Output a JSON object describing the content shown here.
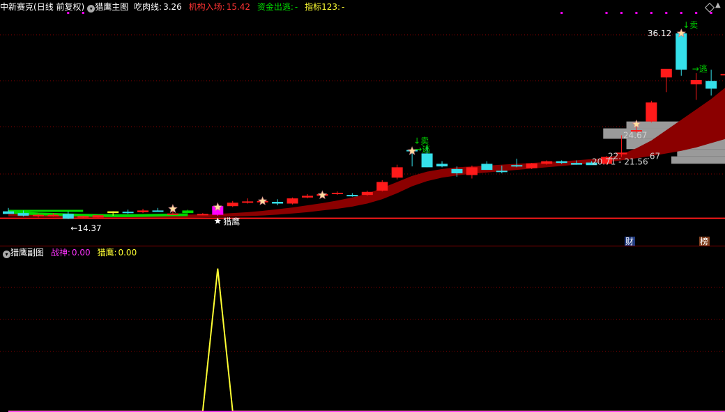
{
  "main_header": {
    "stock": "中新赛克",
    "period": "(日线 前复权)",
    "indicator_name": "猎鹰主图",
    "chi_rou_label": "吃肉线:",
    "chi_rou_value": "3.26",
    "ji_gou_label": "机构入场:",
    "ji_gou_value": "15.42",
    "zi_jin_label": "资金出逃:",
    "zi_jin_value": "-",
    "zhi_biao_label": "指标123:",
    "zhi_biao_value": "-"
  },
  "sub_header": {
    "indicator_name": "猎鹰副图",
    "zhan_shen_label": "战神:",
    "zhan_shen_value": "0.00",
    "lie_ying_label": "猎鹰:",
    "lie_ying_value": "0.00"
  },
  "annotations": {
    "low_price": "←14.37",
    "high_price": "36.12",
    "lie_ying_signal": "猎鹰",
    "escape_1": "→逃",
    "escape_2": "→逃",
    "sell_1": "↓卖",
    "sell_2": "↓卖",
    "zone_top": "24.67",
    "zone_mid": "22.",
    "zone_mid_right": ".67",
    "zone_low": "20.71 - 21.56",
    "badge_cai": "财",
    "badge_bang": "榜"
  },
  "colors": {
    "up": "#ff1a1a",
    "down": "#35e0ea",
    "band": "#8b0000",
    "green": "#00d800",
    "yellow": "#ffff33",
    "magenta": "#ff00ff",
    "grid": "#8b0000"
  },
  "chart_data": [
    {
      "type": "candlestick",
      "title": "中新赛克 (日线 前复权)",
      "ylim": [
        13.5,
        37.5
      ],
      "reference_line": 14.4,
      "candles": [
        {
          "o": 15.2,
          "h": 15.6,
          "l": 15.0,
          "c": 14.9,
          "col": "down"
        },
        {
          "o": 15.0,
          "h": 15.3,
          "l": 14.6,
          "c": 14.7,
          "col": "down"
        },
        {
          "o": 14.8,
          "h": 14.95,
          "l": 14.5,
          "c": 14.72,
          "col": "up"
        },
        {
          "o": 14.8,
          "h": 15.0,
          "l": 14.6,
          "c": 14.72,
          "col": "up"
        },
        {
          "o": 14.9,
          "h": 15.2,
          "l": 14.3,
          "c": 14.35,
          "col": "down"
        },
        {
          "o": 14.55,
          "h": 14.7,
          "l": 14.37,
          "c": 14.65,
          "col": "up"
        },
        {
          "o": 14.5,
          "h": 14.8,
          "l": 14.37,
          "c": 14.75,
          "col": "up"
        },
        {
          "o": 15.0,
          "h": 15.2,
          "l": 14.7,
          "c": 15.2,
          "col": "yellow"
        },
        {
          "o": 15.1,
          "h": 15.4,
          "l": 14.9,
          "c": 15.15,
          "col": "down"
        },
        {
          "o": 15.1,
          "h": 15.5,
          "l": 15.0,
          "c": 15.3,
          "col": "up"
        },
        {
          "o": 15.3,
          "h": 15.6,
          "l": 15.2,
          "c": 15.2,
          "col": "down"
        },
        {
          "o": 14.9,
          "h": 15.8,
          "l": 14.8,
          "c": 14.95,
          "col": "up"
        },
        {
          "o": 15.3,
          "h": 15.4,
          "l": 15.0,
          "c": 15.0,
          "col": "green"
        },
        {
          "o": 14.9,
          "h": 15.0,
          "l": 14.75,
          "c": 14.8,
          "col": "up"
        },
        {
          "o": 14.8,
          "h": 16.0,
          "l": 14.7,
          "c": 15.8,
          "col": "magenta"
        },
        {
          "o": 15.8,
          "h": 16.4,
          "l": 15.7,
          "c": 16.2,
          "col": "up"
        },
        {
          "o": 16.2,
          "h": 16.7,
          "l": 16.1,
          "c": 16.35,
          "col": "up"
        },
        {
          "o": 16.4,
          "h": 16.7,
          "l": 16.2,
          "c": 16.3,
          "col": "up"
        },
        {
          "o": 16.3,
          "h": 16.6,
          "l": 15.9,
          "c": 16.1,
          "col": "down"
        },
        {
          "o": 16.1,
          "h": 16.8,
          "l": 16.0,
          "c": 16.7,
          "col": "up"
        },
        {
          "o": 16.8,
          "h": 17.2,
          "l": 16.7,
          "c": 17.0,
          "col": "up"
        },
        {
          "o": 17.0,
          "h": 17.4,
          "l": 16.9,
          "c": 17.2,
          "col": "up"
        },
        {
          "o": 17.2,
          "h": 17.5,
          "l": 17.1,
          "c": 17.35,
          "col": "up"
        },
        {
          "o": 17.1,
          "h": 17.3,
          "l": 16.9,
          "c": 17.0,
          "col": "down"
        },
        {
          "o": 17.1,
          "h": 17.6,
          "l": 17.0,
          "c": 17.45,
          "col": "up"
        },
        {
          "o": 17.6,
          "h": 18.8,
          "l": 17.5,
          "c": 18.6,
          "col": "up"
        },
        {
          "o": 19.1,
          "h": 20.6,
          "l": 18.9,
          "c": 20.3,
          "col": "up"
        },
        {
          "o": 22.3,
          "h": 22.5,
          "l": 20.4,
          "c": 22.3,
          "col": "down"
        },
        {
          "o": 21.9,
          "h": 22.7,
          "l": 20.3,
          "c": 20.3,
          "col": "down"
        },
        {
          "o": 20.7,
          "h": 21.0,
          "l": 20.3,
          "c": 20.4,
          "col": "down"
        },
        {
          "o": 20.1,
          "h": 20.4,
          "l": 19.2,
          "c": 19.6,
          "col": "down"
        },
        {
          "o": 19.4,
          "h": 20.5,
          "l": 19.0,
          "c": 20.3,
          "col": "up"
        },
        {
          "o": 20.7,
          "h": 21.0,
          "l": 20.0,
          "c": 20.0,
          "col": "down"
        },
        {
          "o": 19.9,
          "h": 20.5,
          "l": 19.6,
          "c": 19.8,
          "col": "down"
        },
        {
          "o": 20.4,
          "h": 21.3,
          "l": 20.3,
          "c": 20.55,
          "col": "down"
        },
        {
          "o": 20.2,
          "h": 20.8,
          "l": 20.1,
          "c": 20.75,
          "col": "up"
        },
        {
          "o": 20.7,
          "h": 21.1,
          "l": 20.6,
          "c": 21.0,
          "col": "up"
        },
        {
          "o": 21.0,
          "h": 21.1,
          "l": 20.7,
          "c": 20.8,
          "col": "down"
        },
        {
          "o": 20.8,
          "h": 21.1,
          "l": 20.6,
          "c": 20.6,
          "col": "down"
        },
        {
          "o": 20.85,
          "h": 21.0,
          "l": 20.6,
          "c": 20.55,
          "col": "down"
        },
        {
          "o": 20.7,
          "h": 21.6,
          "l": 20.6,
          "c": 21.5,
          "col": "up"
        },
        {
          "o": 21.8,
          "h": 24.0,
          "l": 21.5,
          "c": 22.0,
          "col": "up"
        },
        {
          "o": 24.5,
          "h": 25.6,
          "l": 24.3,
          "c": 24.6,
          "col": "up"
        },
        {
          "o": 25.6,
          "h": 28.0,
          "l": 25.5,
          "c": 27.8,
          "col": "up"
        },
        {
          "o": 30.7,
          "h": 31.6,
          "l": 29.0,
          "c": 31.7,
          "col": "up"
        },
        {
          "o": 31.6,
          "h": 36.12,
          "l": 30.9,
          "c": 35.8,
          "col": "down"
        },
        {
          "o": 30.4,
          "h": 31.2,
          "l": 28.1,
          "c": 29.9,
          "col": "up"
        },
        {
          "o": 30.3,
          "h": 31.6,
          "l": 28.6,
          "c": 29.4,
          "col": "down"
        },
        {
          "o": 31.1,
          "h": 32.4,
          "l": 29.3,
          "c": 31.1,
          "col": "up"
        }
      ],
      "band": {
        "upper": [
          15.0,
          14.9,
          14.8,
          14.75,
          14.75,
          14.75,
          14.75,
          14.75,
          14.75,
          14.78,
          14.8,
          14.8,
          14.82,
          14.85,
          14.9,
          15.0,
          15.1,
          15.25,
          15.45,
          15.65,
          15.9,
          16.15,
          16.45,
          16.8,
          17.25,
          17.9,
          18.6,
          19.3,
          19.8,
          20.1,
          20.3,
          20.4,
          20.5,
          20.6,
          20.7,
          20.8,
          20.9,
          21.0,
          21.1,
          21.25,
          21.4,
          21.8,
          22.5,
          23.4,
          24.6,
          25.8,
          27.0,
          28.2,
          29.6
        ],
        "lower": [
          14.6,
          14.58,
          14.55,
          14.52,
          14.5,
          14.5,
          14.5,
          14.5,
          14.5,
          14.5,
          14.5,
          14.5,
          14.5,
          14.52,
          14.55,
          14.6,
          14.65,
          14.72,
          14.82,
          14.95,
          15.1,
          15.3,
          15.5,
          15.75,
          16.1,
          16.6,
          17.3,
          18.1,
          18.7,
          19.1,
          19.35,
          19.55,
          19.7,
          19.85,
          20.0,
          20.15,
          20.3,
          20.45,
          20.6,
          20.75,
          20.9,
          21.1,
          21.35,
          21.6,
          21.9,
          22.2,
          22.6,
          23.1,
          23.6
        ]
      },
      "green_lines": {
        "a": [
          15.25,
          15.25,
          15.25,
          15.25,
          15.25,
          15.25
        ],
        "b": [
          15.1,
          15.0,
          14.9,
          14.85,
          14.8,
          14.75,
          14.72,
          14.7,
          14.7,
          14.72,
          14.75,
          14.78,
          14.8
        ]
      },
      "volume_profile": [
        {
          "price_lo": 20.71,
          "price_hi": 21.56,
          "width": 0.37
        },
        {
          "price_lo": 21.56,
          "price_hi": 22.4,
          "width": 0.33
        },
        {
          "price_lo": 22.4,
          "price_hi": 23.6,
          "width": 0.68
        },
        {
          "price_lo": 23.6,
          "price_hi": 24.8,
          "width": 0.84
        },
        {
          "price_lo": 24.8,
          "price_hi": 25.6,
          "width": 0.68
        }
      ],
      "signals": {
        "stars": [
          11,
          14,
          17,
          21,
          27,
          42,
          45
        ],
        "lie_ying_index": 14,
        "escape_indices": [
          27,
          46
        ],
        "sell_indices": [
          27,
          45
        ]
      },
      "top_marks": [
        4,
        5,
        37,
        40,
        41,
        42,
        43,
        44,
        45,
        46,
        47,
        48
      ]
    },
    {
      "type": "line",
      "title": "猎鹰副图",
      "ylim": [
        0,
        100
      ],
      "series": [
        {
          "name": "猎鹰",
          "values": [
            0,
            0,
            0,
            0,
            0,
            0,
            0,
            0,
            0,
            0,
            0,
            0,
            0,
            0,
            95,
            0,
            0,
            0,
            0,
            0,
            0,
            0,
            0,
            0,
            0,
            0,
            0,
            0,
            0,
            0,
            0,
            0,
            0,
            0,
            0,
            0,
            0,
            0,
            0,
            0,
            0,
            0,
            0,
            0,
            0,
            0,
            0,
            0,
            0
          ]
        },
        {
          "name": "战神",
          "values": [
            0,
            0,
            0,
            0,
            0,
            0,
            0,
            0,
            0,
            0,
            0,
            0,
            0,
            0,
            0,
            0,
            0,
            0,
            0,
            0,
            0,
            0,
            0,
            0,
            0,
            0,
            0,
            0,
            0,
            0,
            0,
            0,
            0,
            0,
            0,
            0,
            0,
            0,
            0,
            0,
            0,
            0,
            0,
            0,
            0,
            0,
            0,
            0,
            0
          ]
        }
      ]
    }
  ]
}
